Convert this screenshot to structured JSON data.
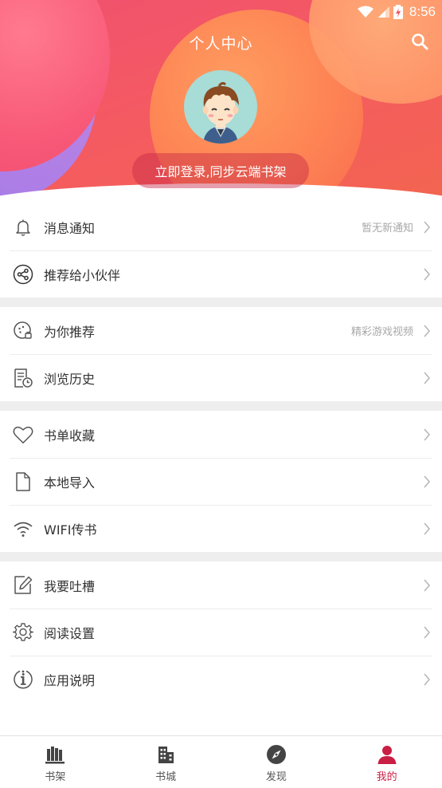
{
  "status_bar": {
    "time": "8:56"
  },
  "header": {
    "title": "个人中心",
    "login_label": "立即登录,同步云端书架"
  },
  "groups": [
    {
      "items": [
        {
          "label": "消息通知",
          "hint": "暂无新通知",
          "icon": "bell-icon"
        },
        {
          "label": "推荐给小伙伴",
          "hint": "",
          "icon": "share-icon"
        }
      ]
    },
    {
      "items": [
        {
          "label": "为你推荐",
          "hint": "精彩游戏视频",
          "icon": "recommend-icon"
        },
        {
          "label": "浏览历史",
          "hint": "",
          "icon": "history-icon"
        }
      ]
    },
    {
      "items": [
        {
          "label": "书单收藏",
          "hint": "",
          "icon": "heart-icon"
        },
        {
          "label": "本地导入",
          "hint": "",
          "icon": "file-icon"
        },
        {
          "label": "WIFI传书",
          "hint": "",
          "icon": "wifi-icon"
        }
      ]
    },
    {
      "items": [
        {
          "label": "我要吐槽",
          "hint": "",
          "icon": "edit-icon"
        },
        {
          "label": "阅读设置",
          "hint": "",
          "icon": "gear-icon"
        },
        {
          "label": "应用说明",
          "hint": "",
          "icon": "info-icon"
        }
      ]
    }
  ],
  "bottom_nav": [
    {
      "label": "书架",
      "icon": "bookshelf-icon",
      "active": false
    },
    {
      "label": "书城",
      "icon": "bookstore-icon",
      "active": false
    },
    {
      "label": "发现",
      "icon": "compass-icon",
      "active": false
    },
    {
      "label": "我的",
      "icon": "profile-icon",
      "active": true
    }
  ],
  "colors": {
    "accent": "#c91f45",
    "header_gradient": [
      "#f0506f",
      "#f3654f"
    ]
  }
}
